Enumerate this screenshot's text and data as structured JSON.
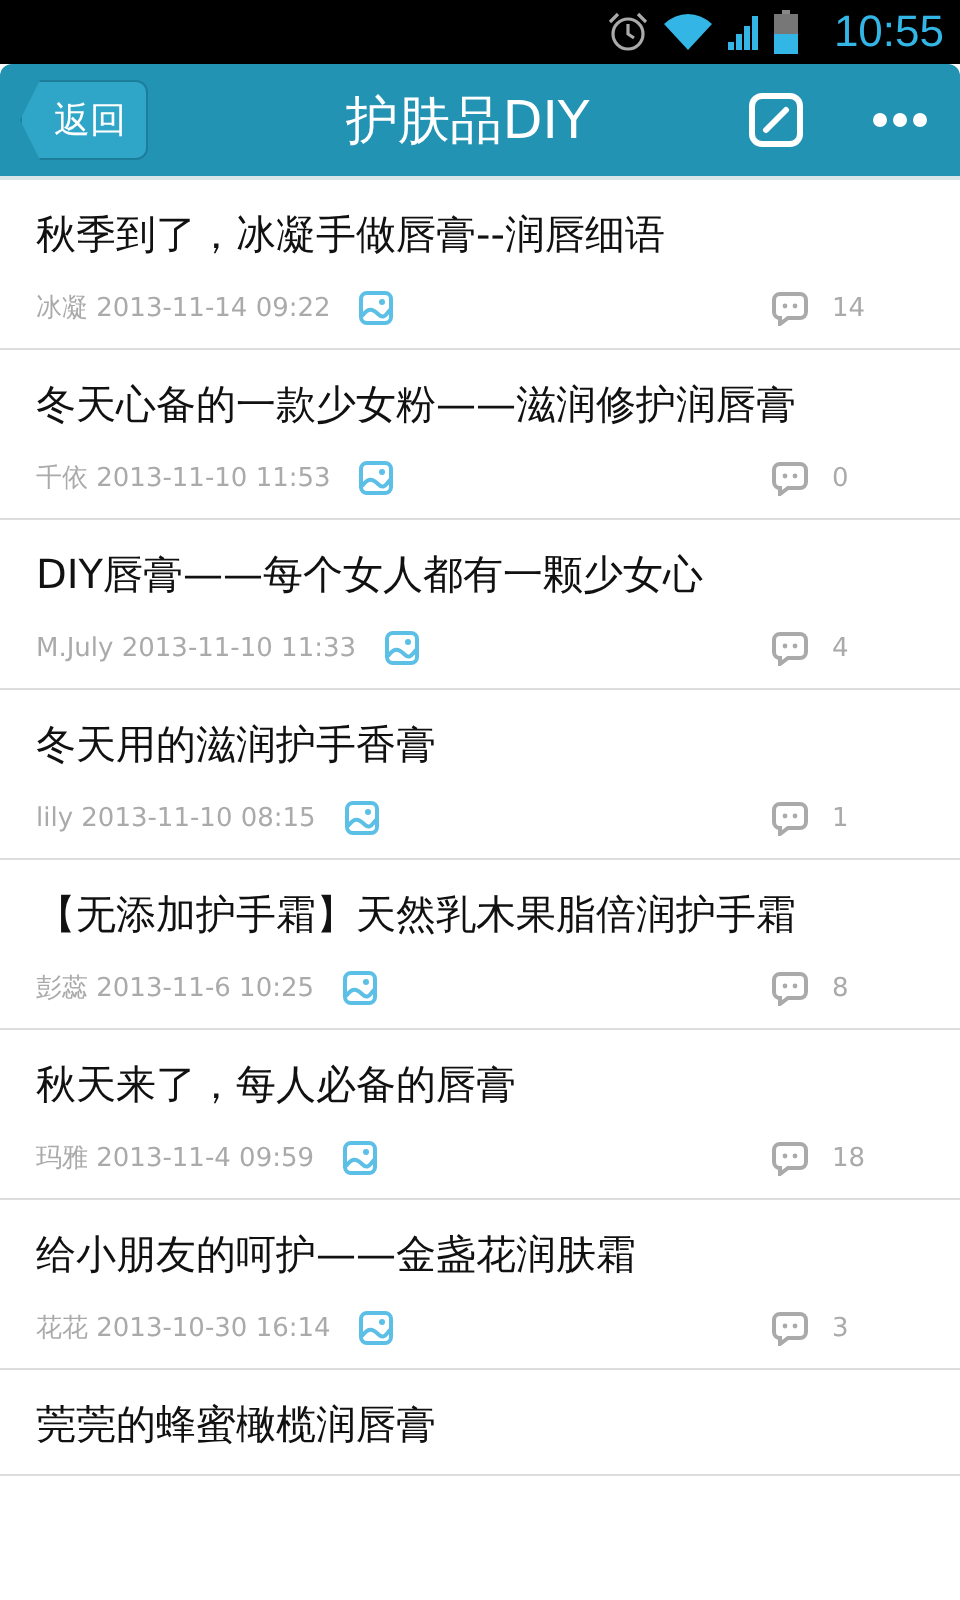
{
  "status_bar": {
    "time": "10:55"
  },
  "header": {
    "back": "返回",
    "title": "护肤品DIY"
  },
  "posts": [
    {
      "title": "秋季到了，冰凝手做唇膏--润唇细语",
      "author": "冰凝",
      "date": "2013-11-14 09:22",
      "comments": "14"
    },
    {
      "title": "冬天心备的一款少女粉——滋润修护润唇膏",
      "author": "千依",
      "date": "2013-11-10 11:53",
      "comments": "0"
    },
    {
      "title": "DIY唇膏——每个女人都有一颗少女心",
      "author": "M.July",
      "date": "2013-11-10 11:33",
      "comments": "4"
    },
    {
      "title": "冬天用的滋润护手香膏",
      "author": "lily",
      "date": "2013-11-10 08:15",
      "comments": "1"
    },
    {
      "title": "【无添加护手霜】天然乳木果脂倍润护手霜",
      "author": "彭蕊",
      "date": "2013-11-6 10:25",
      "comments": "8"
    },
    {
      "title": "秋天来了，每人必备的唇膏",
      "author": "玛雅",
      "date": "2013-11-4 09:59",
      "comments": "18"
    },
    {
      "title": "给小朋友的呵护——金盏花润肤霜",
      "author": "花花",
      "date": "2013-10-30 16:14",
      "comments": "3"
    },
    {
      "title": "莞莞的蜂蜜橄榄润唇膏"
    }
  ]
}
